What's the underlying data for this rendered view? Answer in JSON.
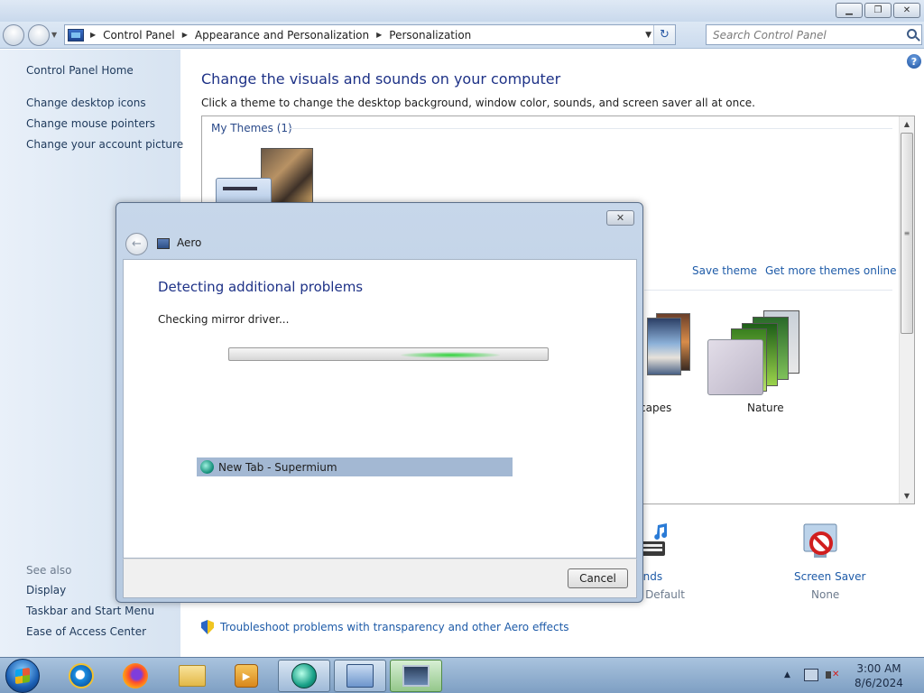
{
  "window": {
    "minimize_icon": "minimize-icon",
    "maximize_icon": "restore-icon",
    "close_icon": "close-icon"
  },
  "address": {
    "breadcrumbs": [
      "Control Panel",
      "Appearance and Personalization",
      "Personalization"
    ],
    "search_placeholder": "Search Control Panel"
  },
  "sidebar": {
    "home": "Control Panel Home",
    "links": [
      "Change desktop icons",
      "Change mouse pointers",
      "Change your account picture"
    ],
    "see_also_title": "See also",
    "see_also": [
      "Display",
      "Taskbar and Start Menu",
      "Ease of Access Center"
    ]
  },
  "main": {
    "heading": "Change the visuals and sounds on your computer",
    "subheading": "Click a theme to change the desktop background, window color, sounds, and screen saver all at once.",
    "my_themes": "My Themes (1)",
    "save_theme": "Save theme",
    "more_themes": "Get more themes online",
    "themes": [
      "capes",
      "Nature"
    ],
    "sounds_label": "unds",
    "sounds_value": "s Default",
    "screen_saver_label": "Screen Saver",
    "screen_saver_value": "None",
    "troubleshoot_link": "Troubleshoot problems with transparency and other Aero effects"
  },
  "dialog": {
    "title": "Aero",
    "heading": "Detecting additional problems",
    "status": "Checking mirror driver...",
    "cancel": "Cancel"
  },
  "tooltip": {
    "label": "New Tab - Supermium"
  },
  "taskbar": {
    "time": "3:00 AM",
    "date": "8/6/2024"
  },
  "colors": {
    "link": "#1e5ba8",
    "heading": "#1e3287",
    "progress_glow": "#2ed33a"
  }
}
